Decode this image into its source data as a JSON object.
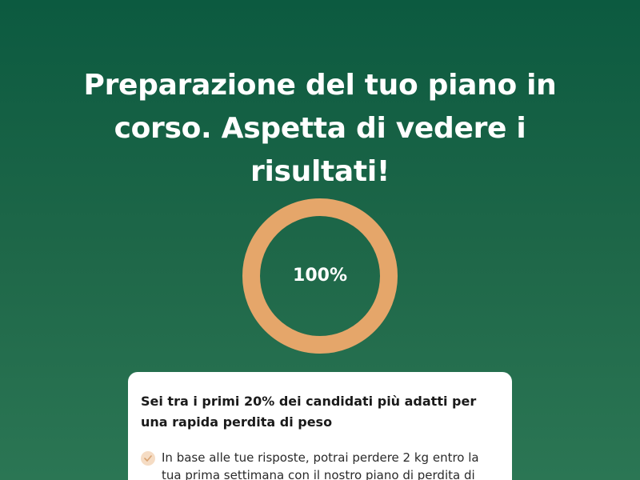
{
  "header": {
    "title": "Preparazione del tuo piano in corso. Aspetta di vedere i risultati!"
  },
  "progress": {
    "value": 100,
    "label": "100%",
    "ring_color": "#e5a66a"
  },
  "card": {
    "heading": "Sei tra i primi 20% dei candidati più adatti per una rapida perdita di peso",
    "items": [
      {
        "icon": "check-icon",
        "text": "In base alle tue risposte, potrai perdere 2 kg entro la tua prima settimana con il nostro piano di perdita di peso"
      }
    ]
  },
  "colors": {
    "background_top": "#0c5a40",
    "background_bottom": "#2b7654",
    "check_bg": "#f5dcc4",
    "check_mark": "#d9a373"
  }
}
